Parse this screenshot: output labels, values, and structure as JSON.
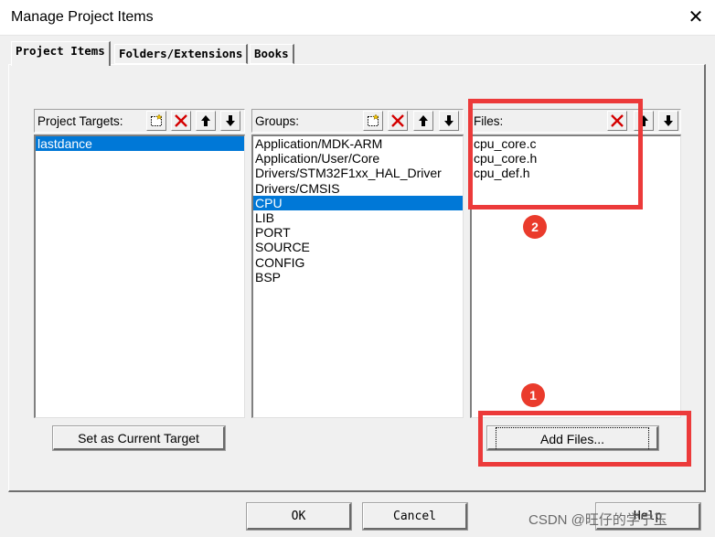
{
  "window": {
    "title": "Manage Project Items",
    "close_glyph": "✕"
  },
  "tabs": [
    {
      "label": "Project Items",
      "active": true
    },
    {
      "label": "Folders/Extensions",
      "active": false
    },
    {
      "label": "Books",
      "active": false
    }
  ],
  "project_targets": {
    "label": "Project Targets:",
    "items": [
      "lastdance"
    ],
    "selected": "lastdance",
    "set_current_label": "Set as Current Target"
  },
  "groups": {
    "label": "Groups:",
    "items": [
      "Application/MDK-ARM",
      "Application/User/Core",
      "Drivers/STM32F1xx_HAL_Driver",
      "Drivers/CMSIS",
      "CPU",
      "LIB",
      "PORT",
      "SOURCE",
      "CONFIG",
      "BSP"
    ],
    "selected": "CPU"
  },
  "files": {
    "label": "Files:",
    "items": [
      "cpu_core.c",
      "cpu_core.h",
      "cpu_def.h"
    ],
    "add_files_label": "Add Files..."
  },
  "toolbar_icons": {
    "new": "new-item-icon",
    "delete": "delete-icon",
    "move_up": "arrow-up-icon",
    "move_down": "arrow-down-icon"
  },
  "buttons": {
    "ok": "OK",
    "cancel": "Cancel",
    "help": "Help"
  },
  "annotations": {
    "badge_1": "1",
    "badge_2": "2",
    "color": "#ec3a3a"
  },
  "watermark": "CSDN @旺仔的学宁玉"
}
